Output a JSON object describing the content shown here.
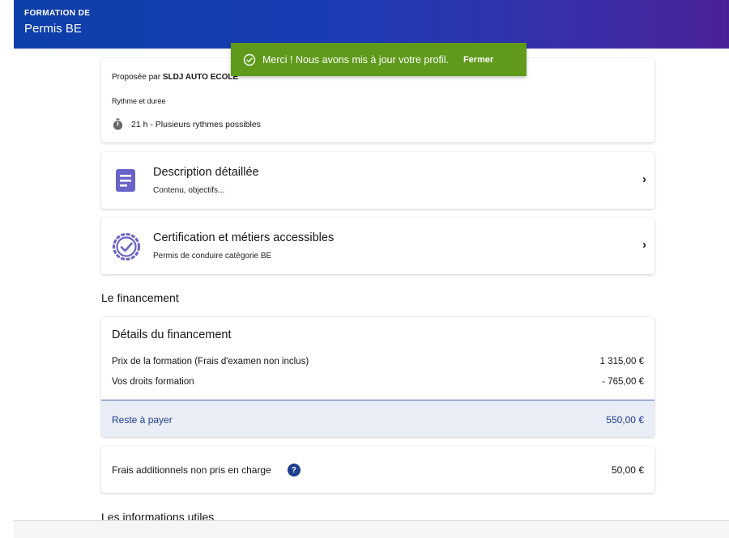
{
  "header": {
    "eyebrow": "FORMATION DE",
    "title": "Permis BE"
  },
  "toast": {
    "message": "Merci ! Nous avons mis à jour votre profil.",
    "close": "Fermer",
    "color": "#5f9a1b"
  },
  "summary": {
    "proposee_prefix": "Proposée par",
    "provider": "SLDJ AUTO ECOLE",
    "rythme_label": "Rythme et durée",
    "duration": "21 h -",
    "rhythm": "Plusieurs rythmes possibles"
  },
  "description_card": {
    "title": "Description détaillée",
    "subtitle": "Contenu, objectifs...",
    "icon": "document-list-icon"
  },
  "certification_card": {
    "title": "Certification et métiers accessibles",
    "subtitle": "Permis de conduire catégorie BE",
    "icon": "certified-badge-icon"
  },
  "financement": {
    "section_title": "Le financement",
    "details_title": "Détails du financement",
    "rows": [
      {
        "label": "Prix de la formation (Frais d'examen non inclus)",
        "value": "1 315,00 €"
      },
      {
        "label": "Vos droits formation",
        "value": "- 765,00 €"
      }
    ],
    "total": {
      "label": "Reste à payer",
      "value": "550,00 €"
    }
  },
  "frais": {
    "label": "Frais additionnels non pris en charge",
    "help": "?",
    "value": "50,00 €"
  },
  "infos": {
    "section_title": "Les informations utiles"
  }
}
